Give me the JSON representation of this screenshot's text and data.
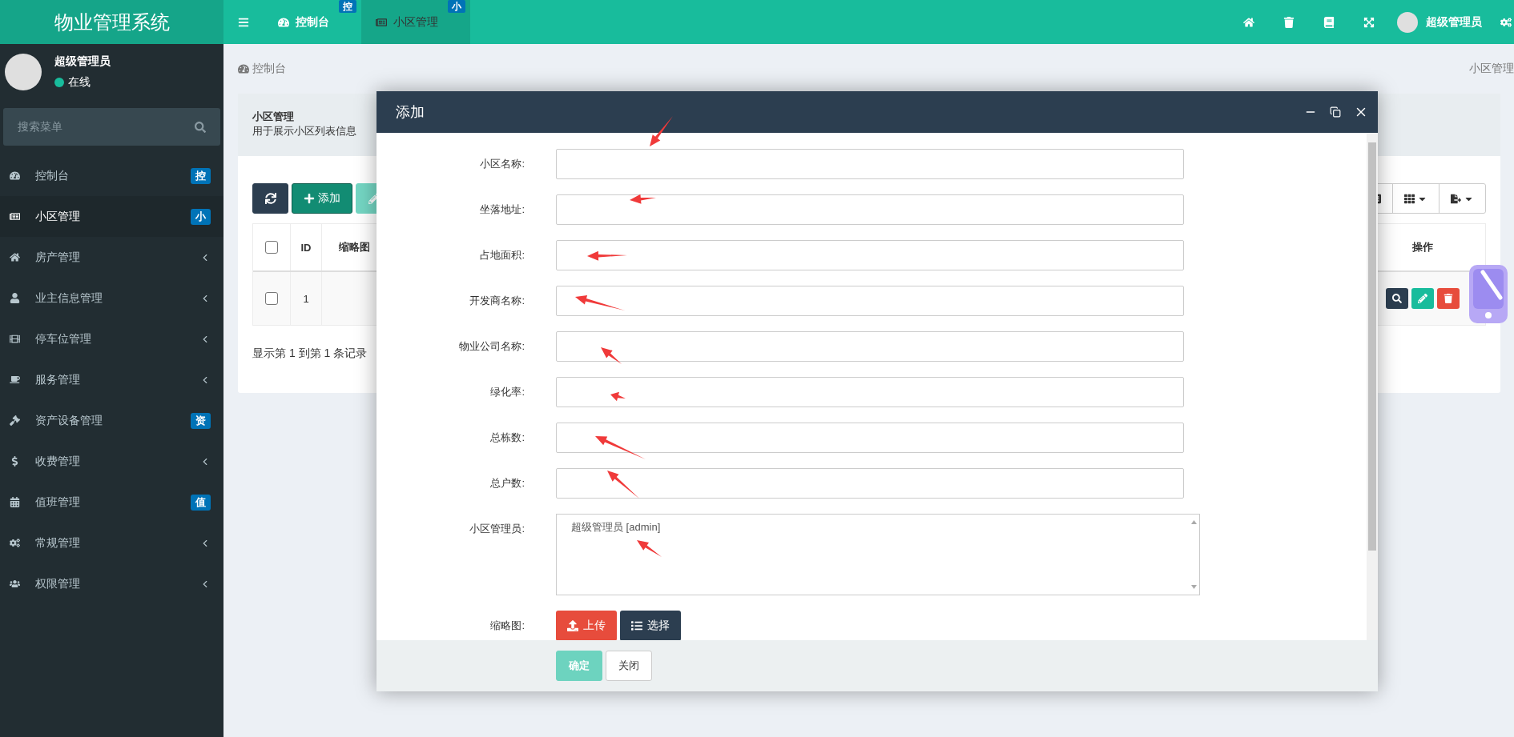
{
  "topbar": {
    "logo": "物业管理系统",
    "tabs": [
      {
        "label": "控制台",
        "badge": "控",
        "selected": false
      },
      {
        "label": "小区管理",
        "badge": "小",
        "selected": true
      }
    ],
    "user": "超级管理员"
  },
  "sidebar": {
    "user": {
      "name": "超级管理员",
      "status": "在线",
      "online": true
    },
    "search": {
      "placeholder": "搜索菜单"
    },
    "items": [
      {
        "label": "控制台",
        "kind": "badge",
        "badge": "控",
        "selected": false
      },
      {
        "label": "小区管理",
        "kind": "badge",
        "badge": "小",
        "selected": true
      },
      {
        "label": "房产管理",
        "kind": "submenu",
        "selected": false
      },
      {
        "label": "业主信息管理",
        "kind": "submenu",
        "selected": false
      },
      {
        "label": "停车位管理",
        "kind": "submenu",
        "selected": false
      },
      {
        "label": "服务管理",
        "kind": "submenu",
        "selected": false
      },
      {
        "label": "资产设备管理",
        "kind": "badge",
        "badge": "资",
        "selected": false
      },
      {
        "label": "收费管理",
        "kind": "submenu",
        "selected": false
      },
      {
        "label": "值班管理",
        "kind": "badge",
        "badge": "值",
        "selected": false
      },
      {
        "label": "常规管理",
        "kind": "submenu",
        "selected": false
      },
      {
        "label": "权限管理",
        "kind": "submenu",
        "selected": false
      }
    ]
  },
  "breadcrumb": {
    "left": "控制台",
    "right": "小区管理"
  },
  "panel": {
    "title": "小区管理",
    "description": "用于展示小区列表信息",
    "toolbar": [
      {
        "kind": "refresh",
        "disabled": false
      },
      {
        "kind": "add",
        "label": "添加",
        "disabled": false
      },
      {
        "kind": "edit",
        "disabled": true
      }
    ],
    "table": {
      "header_checked": false,
      "columns": [
        "ID",
        "缩略图",
        "操作"
      ],
      "rows": [
        {
          "checked": false,
          "id": "1"
        }
      ]
    },
    "footer": "显示第 1 到第 1 条记录"
  },
  "dialog": {
    "title": "添加",
    "fields": [
      {
        "label": "小区名称:",
        "kind": "input"
      },
      {
        "label": "坐落地址:",
        "kind": "input"
      },
      {
        "label": "占地面积:",
        "kind": "input"
      },
      {
        "label": "开发商名称:",
        "kind": "input"
      },
      {
        "label": "物业公司名称:",
        "kind": "input"
      },
      {
        "label": "绿化率:",
        "kind": "input"
      },
      {
        "label": "总栋数:",
        "kind": "input"
      },
      {
        "label": "总户数:",
        "kind": "input"
      },
      {
        "label": "小区管理员:",
        "kind": "textarea",
        "value": "超级管理员 [admin]"
      },
      {
        "label": "缩略图:",
        "kind": "upload",
        "buttons": [
          "上传",
          "选择"
        ]
      }
    ],
    "buttons": [
      {
        "label": "确定",
        "kind": "primary",
        "disabled": true
      },
      {
        "label": "关闭",
        "kind": "default"
      }
    ]
  }
}
